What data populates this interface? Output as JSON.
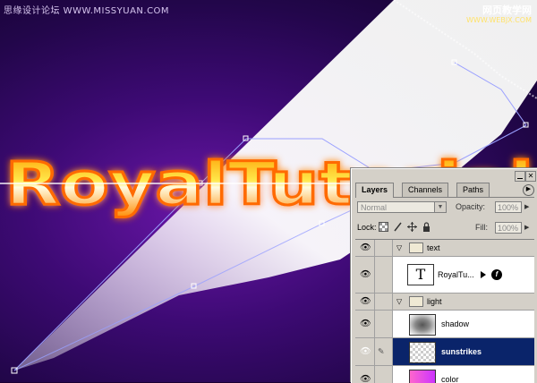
{
  "watermarks": {
    "top_left": "思缘设计论坛 WWW.MISSYUAN.COM",
    "top_right_cn": "网页教学网",
    "top_right_url": "WWW.WEBJX.COM"
  },
  "artwork": {
    "logo_text": "RoyalTutorial",
    "colors": {
      "background_center": "#6a16a8",
      "background_edge": "#12022a",
      "logo_fill": "#ffb000",
      "logo_outline": "#ff7a00",
      "logo_glow": "#ff3fbf",
      "light_beam": "#ffffff"
    }
  },
  "layers_panel": {
    "tabs": [
      "Layers",
      "Channels",
      "Paths"
    ],
    "active_tab": "Layers",
    "blend_mode": "Normal",
    "opacity_label": "Opacity:",
    "opacity_value": "100%",
    "lock_label": "Lock:",
    "fill_label": "Fill:",
    "fill_value": "100%",
    "menu_arrow": "▶",
    "layers": [
      {
        "name": "text",
        "kind": "group",
        "visible": true
      },
      {
        "name": "RoyalTu...",
        "kind": "text",
        "visible": true,
        "has_effects": true,
        "thumb_glyph": "T",
        "fx_glyph": "f"
      },
      {
        "name": "light",
        "kind": "group",
        "visible": true
      },
      {
        "name": "shadow",
        "kind": "layer",
        "visible": true
      },
      {
        "name": "sunstrikes",
        "kind": "layer",
        "visible": true,
        "selected": true
      },
      {
        "name": "color",
        "kind": "layer",
        "visible": true
      }
    ]
  }
}
